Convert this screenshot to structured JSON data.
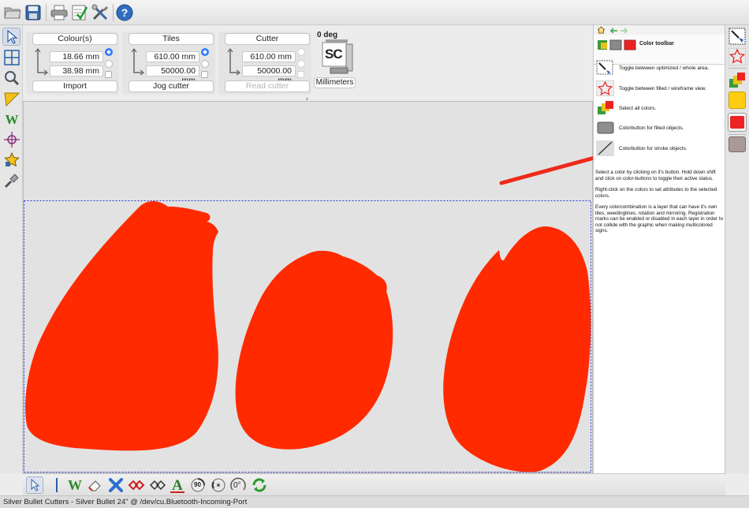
{
  "toolbar": {
    "icons": [
      "open-folder-icon",
      "save-icon",
      "print-icon",
      "checklist-icon",
      "tools-icon",
      "help-icon"
    ]
  },
  "left_tools": {
    "icons": [
      "arrow-select-icon",
      "grid-icon",
      "magnifier-icon",
      "ruler-icon",
      "weed-w-icon",
      "crosshair-icon",
      "star-icon",
      "knife-icon"
    ]
  },
  "properties": {
    "colours": {
      "title": "Colour(s)",
      "width": "18.66 mm",
      "height": "38.98 mm",
      "button": "Import"
    },
    "tiles": {
      "title": "Tiles",
      "width": "610.00 mm",
      "height": "50000.00 mm",
      "button": "Jog cutter"
    },
    "cutter": {
      "title": "Cutter",
      "width": "610.00 mm",
      "height": "50000.00 mm",
      "button": "Read cutter"
    },
    "rotation": "0 deg",
    "logo_text": "SC",
    "units_button": "Millimeters"
  },
  "canvas": {
    "shape_color": "#ff2a00",
    "shapes": [
      "tulip-petal-left",
      "tulip-petal-middle",
      "tulip-petal-right"
    ]
  },
  "help": {
    "title": "Color toolbar",
    "rows": [
      {
        "icon": "optimized-area-icon",
        "text": "Toggle between optimized / whole area."
      },
      {
        "icon": "filled-wireframe-star-icon",
        "text": "Toggle between filled / wireframe view."
      },
      {
        "icon": "select-all-colors-icon",
        "text": "Select all colors."
      },
      {
        "icon": "filled-color-button-icon",
        "text": "Colorbutton for filled objects."
      },
      {
        "icon": "stroke-color-button-icon",
        "text": "Colorbutton for stroke objects."
      }
    ],
    "paragraphs": [
      "Select a color by clicking on it's button. Hold down shift and click on color-buttons to toggle their active status.",
      "Right-click on the colors to set attributes to the selected colors.",
      "Every colorcombination is a layer that can have it's own tiles, weedinglines, rotation and mirroring. Registration marks can be enabled or disabled in each layer in order to not collide with the graphic when making multicolored signs."
    ]
  },
  "right_tools": {
    "icons": [
      "optimized-area-icon",
      "star-outline-icon",
      "select-all-colors-icon",
      "yellow-color-button",
      "red-color-button",
      "gray-color-button"
    ],
    "colors": {
      "yellow": "#ffcc11",
      "red": "#ee2222",
      "gray": "#a99a9a"
    }
  },
  "bottom_tools": {
    "icons": [
      "arrow-select-icon",
      "separator-icon",
      "weed-w-icon",
      "eraser-icon",
      "delete-x-icon",
      "node-red-icon",
      "node-outline-icon",
      "text-a-icon",
      "rotate-90-icon",
      "rotate-knob-icon",
      "rotate-0-icon",
      "refresh-green-icon"
    ],
    "labels": {
      "rotate90": "90",
      "rotate0": "0°"
    }
  },
  "annotation": {
    "arrow_color": "#ee2a1a"
  },
  "status": {
    "text": "Silver Bullet Cutters - Silver Bullet 24\" @ /dev/cu.Bluetooth-Incoming-Port"
  }
}
